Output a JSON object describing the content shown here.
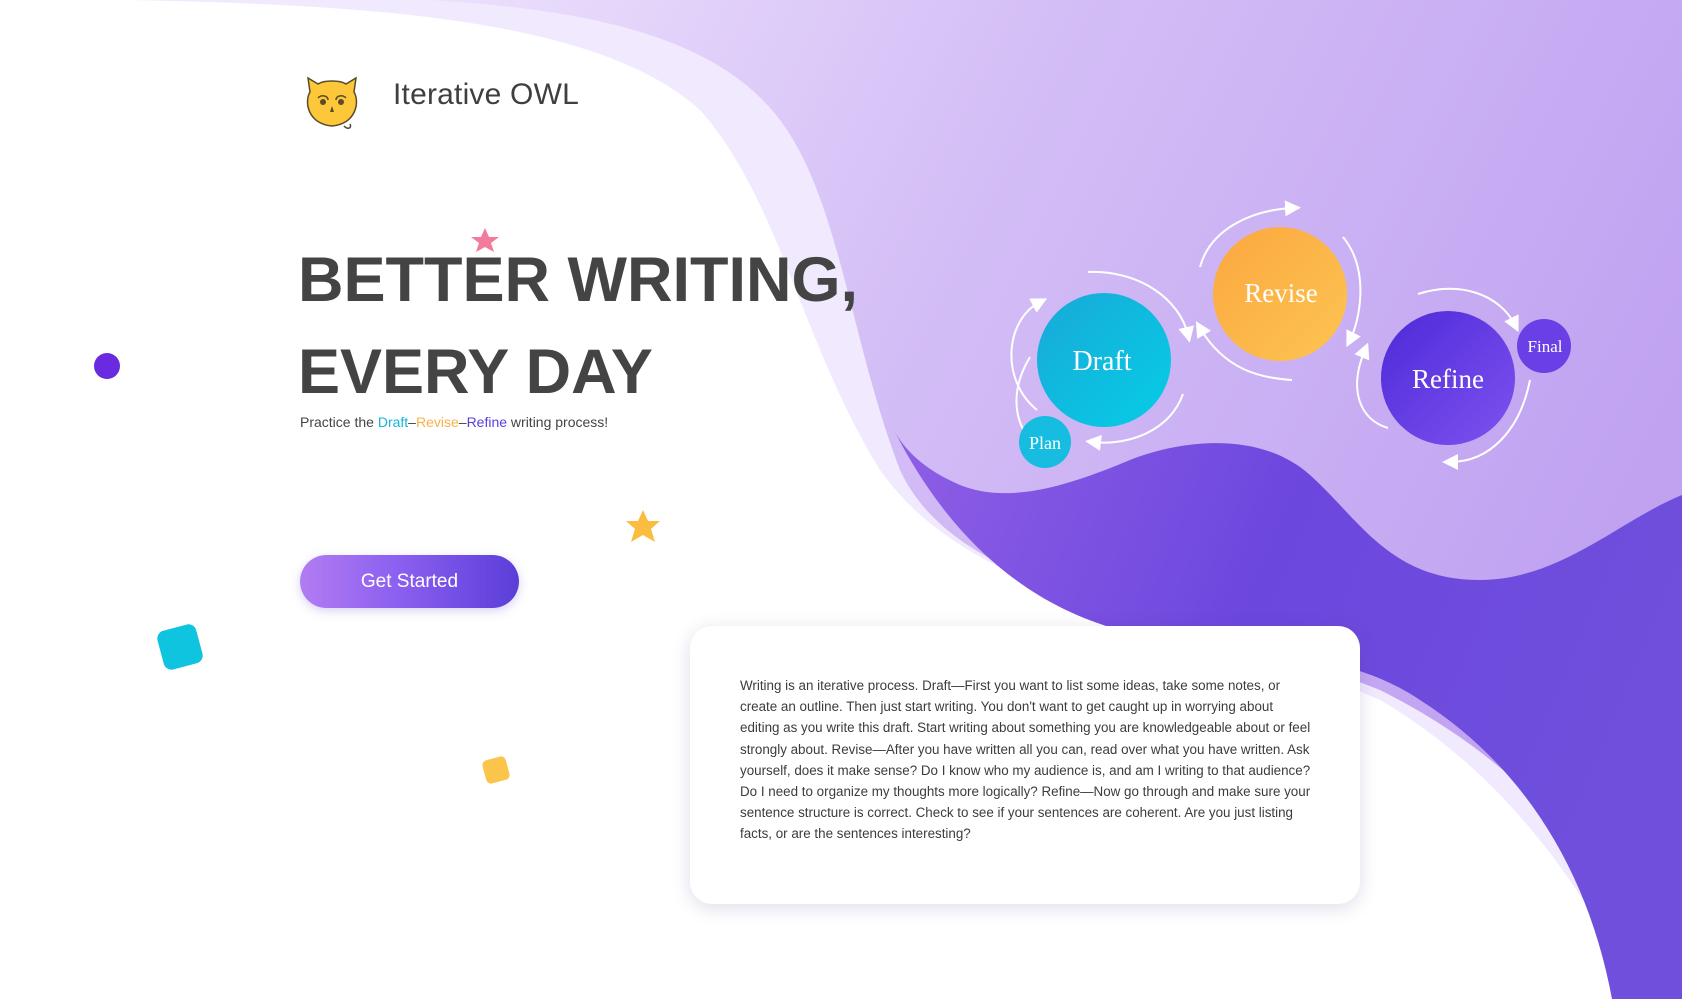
{
  "brand": {
    "name": "Iterative OWL",
    "logo_icon": "owl-logo-icon"
  },
  "hero": {
    "line1": "BETTER WRITING,",
    "line2": "EVERY DAY",
    "tagline": {
      "prefix": "Practice the ",
      "draft": "Draft",
      "dash1": "–",
      "revise": "Revise",
      "dash2": "–",
      "refine": "Refine",
      "suffix": " writing process!"
    },
    "cta_label": "Get Started"
  },
  "process_diagram": {
    "nodes": [
      {
        "id": "plan",
        "label": "Plan",
        "color": "#16bde0"
      },
      {
        "id": "draft",
        "label": "Draft",
        "color": "#0fc0e3"
      },
      {
        "id": "revise",
        "label": "Revise",
        "color": "#fbb349"
      },
      {
        "id": "refine",
        "label": "Refine",
        "color": "#5b37e2"
      },
      {
        "id": "final",
        "label": "Final",
        "color": "#6a40e6"
      }
    ]
  },
  "info_card": {
    "text": "Writing is an iterative process. Draft—First you want to list some ideas, take some notes, or create an outline. Then just start writing. You don't want to get caught up in worrying about editing as you write this draft. Start writing about something you are knowledgeable about or feel strongly about. Revise—After you have written all you can, read over what you have written. Ask yourself, does it make sense? Do I know who my audience is, and am I writing to that audience? Do I need to organize my thoughts more logically? Refine—Now go through and make sure your sentence structure is correct. Check to see if your sentences are coherent. Are you just listing facts, or are the sentences interesting?"
  },
  "colors": {
    "accent_purple": "#6a3ddf",
    "accent_cyan": "#0fc0e3",
    "accent_orange": "#fbb349",
    "lavender_bg": "#c9aff3",
    "heading_text": "#444444"
  }
}
